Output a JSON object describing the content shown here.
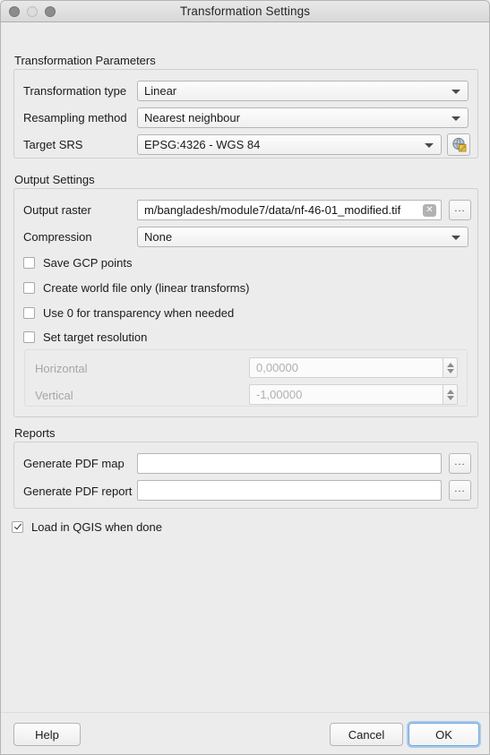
{
  "window": {
    "title": "Transformation Settings",
    "traffic_lights": [
      "close-button",
      "minimize-button",
      "maximize-button"
    ]
  },
  "transformation_parameters": {
    "section_label": "Transformation Parameters",
    "fields": [
      {
        "label": "Transformation type",
        "value": "Linear"
      },
      {
        "label": "Resampling method",
        "value": "Nearest neighbour"
      },
      {
        "label": "Target SRS",
        "value": "EPSG:4326 - WGS 84"
      }
    ],
    "srs_select_icon": "globe-edit-icon"
  },
  "output_settings": {
    "section_label": "Output Settings",
    "output_raster_label": "Output raster",
    "output_raster_value": "m/bangladesh/module7/data/nf-46-01_modified.tif",
    "output_raster_clear_icon": "clear-icon",
    "browse_label": "...",
    "compression_label": "Compression",
    "compression_value": "None",
    "checkboxes": [
      {
        "label": "Save GCP points",
        "checked": false
      },
      {
        "label": "Create world file only (linear transforms)",
        "checked": false
      },
      {
        "label": "Use 0 for transparency when needed",
        "checked": false
      },
      {
        "label": "Set target resolution",
        "checked": false
      }
    ],
    "resolution": {
      "horizontal_label": "Horizontal",
      "horizontal_value": "0,00000",
      "vertical_label": "Vertical",
      "vertical_value": "-1,00000",
      "enabled": false
    }
  },
  "reports": {
    "section_label": "Reports",
    "fields": [
      {
        "label": "Generate PDF map",
        "value": ""
      },
      {
        "label": "Generate PDF report",
        "value": ""
      }
    ],
    "browse_label": "..."
  },
  "load_in_qgis": {
    "label": "Load in QGIS when done",
    "checked": true
  },
  "footer": {
    "help_label": "Help",
    "cancel_label": "Cancel",
    "ok_label": "OK"
  },
  "colors": {
    "window_bg": "#ececec",
    "focus_ring": "#6fa8dc",
    "text": "#1a1a1a",
    "disabled_text": "#a6a6a6"
  }
}
